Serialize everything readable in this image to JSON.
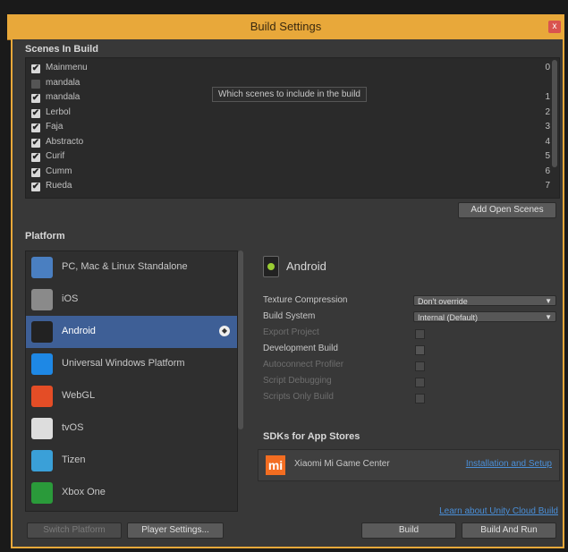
{
  "window": {
    "title": "Build Settings",
    "close_label": "x"
  },
  "scenes": {
    "label": "Scenes In Build",
    "tooltip": "Which scenes to include in the build",
    "items": [
      {
        "name": "Mainmenu",
        "checked": true,
        "index": "0"
      },
      {
        "name": "mandala",
        "checked": false,
        "index": ""
      },
      {
        "name": "mandala",
        "checked": true,
        "index": "1"
      },
      {
        "name": "Lerbol",
        "checked": true,
        "index": "2"
      },
      {
        "name": "Faja",
        "checked": true,
        "index": "3"
      },
      {
        "name": "Abstracto",
        "checked": true,
        "index": "4"
      },
      {
        "name": "Curif",
        "checked": true,
        "index": "5"
      },
      {
        "name": "Cumm",
        "checked": true,
        "index": "6"
      },
      {
        "name": "Rueda",
        "checked": true,
        "index": "7"
      }
    ],
    "add_open_label": "Add Open Scenes"
  },
  "platform": {
    "label": "Platform",
    "items": [
      {
        "name": "PC, Mac & Linux Standalone",
        "icon": "pc-mac-linux-icon",
        "color": "#4a7fc1"
      },
      {
        "name": "iOS",
        "icon": "ios-icon",
        "color": "#8a8a8a"
      },
      {
        "name": "Android",
        "icon": "android-icon",
        "color": "#222222",
        "selected": true
      },
      {
        "name": "Universal Windows Platform",
        "icon": "windows-icon",
        "color": "#1e88e5"
      },
      {
        "name": "WebGL",
        "icon": "html5-icon",
        "color": "#e44d26"
      },
      {
        "name": "tvOS",
        "icon": "tvos-icon",
        "color": "#dddddd"
      },
      {
        "name": "Tizen",
        "icon": "tizen-icon",
        "color": "#3aa0d8"
      },
      {
        "name": "Xbox One",
        "icon": "xbox-icon",
        "color": "#2a9a3a"
      }
    ]
  },
  "details": {
    "title": "Android",
    "rows": [
      {
        "label": "Texture Compression",
        "type": "dropdown",
        "value": "Don't override",
        "dim": false
      },
      {
        "label": "Build System",
        "type": "dropdown",
        "value": "Internal (Default)",
        "dim": false
      },
      {
        "label": "Export Project",
        "type": "checkbox",
        "dim": true
      },
      {
        "label": "Development Build",
        "type": "checkbox",
        "dim": false
      },
      {
        "label": "Autoconnect Profiler",
        "type": "checkbox",
        "dim": true
      },
      {
        "label": "Script Debugging",
        "type": "checkbox",
        "dim": true
      },
      {
        "label": "Scripts Only Build",
        "type": "checkbox",
        "dim": true
      }
    ],
    "sdk_label": "SDKs for App Stores",
    "sdk_name": "Xiaomi Mi Game Center",
    "sdk_logo": "mi",
    "sdk_link": "Installation and Setup",
    "cloud_link": "Learn about Unity Cloud Build"
  },
  "footer": {
    "switch_label": "Switch Platform",
    "player_settings_label": "Player Settings...",
    "build_label": "Build",
    "build_run_label": "Build And Run"
  },
  "colors": {
    "accent": "#e8a83a",
    "selected": "#3e5f96",
    "link": "#4a8fd8"
  }
}
